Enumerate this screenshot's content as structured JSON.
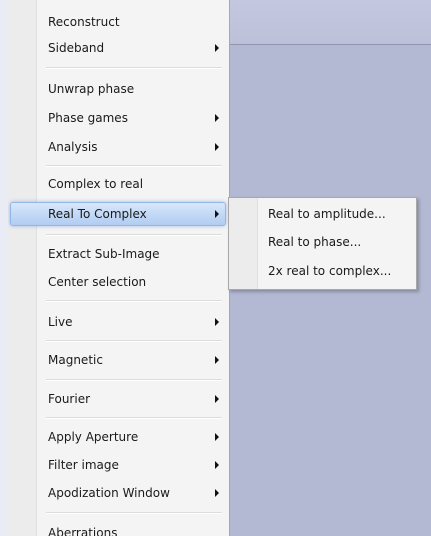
{
  "main_menu": {
    "items": [
      {
        "label": "Reconstruct"
      },
      {
        "label": "Sideband"
      },
      {
        "label": "Unwrap phase"
      },
      {
        "label": "Phase games"
      },
      {
        "label": "Analysis"
      },
      {
        "label": "Complex to real"
      },
      {
        "label": "Real To Complex"
      },
      {
        "label": "Extract Sub-Image"
      },
      {
        "label": "Center selection"
      },
      {
        "label": "Live"
      },
      {
        "label": "Magnetic"
      },
      {
        "label": "Fourier"
      },
      {
        "label": "Apply Aperture"
      },
      {
        "label": "Filter image"
      },
      {
        "label": "Apodization Window"
      },
      {
        "label": "Aberrations"
      }
    ]
  },
  "submenu": {
    "items": [
      {
        "label": "Real to amplitude..."
      },
      {
        "label": "Real to phase..."
      },
      {
        "label": "2x real to complex..."
      }
    ]
  },
  "colors": {
    "highlight": "#c3d9f6",
    "workspace": "#b3b8d3"
  }
}
